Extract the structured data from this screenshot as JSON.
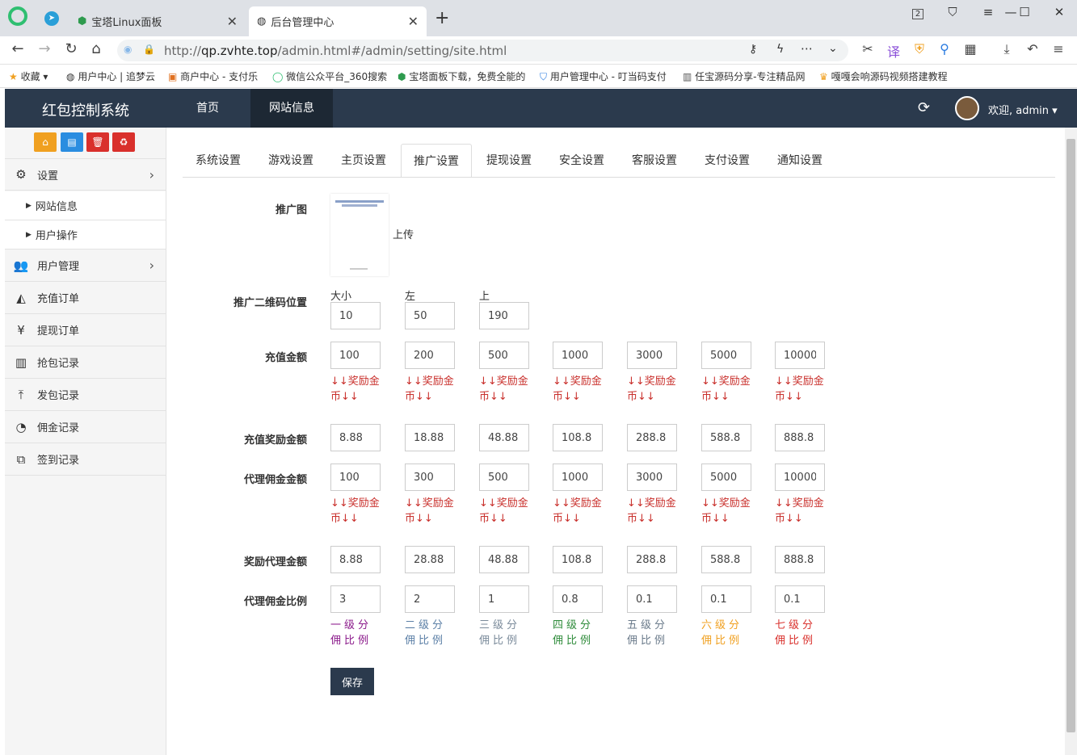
{
  "browser": {
    "tabs": [
      {
        "title": "宝塔Linux面板"
      },
      {
        "title": "后台管理中心"
      }
    ],
    "tab_count_badge": "2",
    "url_prefix": "http://",
    "url_host": "qp.zvhte.top",
    "url_path": "/admin.html#/admin/setting/site.html",
    "bookmarks": [
      "收藏",
      "用户中心 | 追梦云",
      "商户中心 - 支付乐",
      "微信公众平台_360搜索",
      "宝塔面板下载，免费全能的",
      "用户管理中心 - 叮当码支付",
      "任宝源码分享-专注精品网",
      "嘎嘎会响源码视频搭建教程"
    ]
  },
  "header": {
    "brand": "红包控制系统",
    "nav": [
      "首页",
      "网站信息"
    ],
    "welcome": "欢迎, admin"
  },
  "sidebar": {
    "menu": [
      {
        "label": "设置"
      },
      {
        "label": "网站信息"
      },
      {
        "label": "用户操作"
      },
      {
        "label": "用户管理"
      },
      {
        "label": "充值订单"
      },
      {
        "label": "提现订单"
      },
      {
        "label": "抢包记录"
      },
      {
        "label": "发包记录"
      },
      {
        "label": "佣金记录"
      },
      {
        "label": "签到记录"
      }
    ]
  },
  "tabs": [
    "系统设置",
    "游戏设置",
    "主页设置",
    "推广设置",
    "提现设置",
    "安全设置",
    "客服设置",
    "支付设置",
    "通知设置"
  ],
  "form": {
    "promo_image_label": "推广图",
    "upload_label": "上传",
    "qr_position_label": "推广二维码位置",
    "qr_headers": [
      "大小",
      "左",
      "上"
    ],
    "qr_values": [
      "10",
      "50",
      "190"
    ],
    "recharge_amount_label": "充值金额",
    "recharge_amounts": [
      "100",
      "200",
      "500",
      "1000",
      "3000",
      "5000",
      "10000"
    ],
    "reward_hint": "↓↓奖励金币↓↓",
    "recharge_reward_label": "充值奖励金额",
    "recharge_rewards": [
      "8.88",
      "18.88",
      "48.88",
      "108.8",
      "288.8",
      "588.8",
      "888.8"
    ],
    "agent_amount_label": "代理佣金金额",
    "agent_amounts": [
      "100",
      "300",
      "500",
      "1000",
      "3000",
      "5000",
      "10000"
    ],
    "agent_reward_label": "奖励代理金额",
    "agent_rewards": [
      "8.88",
      "28.88",
      "48.88",
      "108.8",
      "288.8",
      "588.8",
      "888.8"
    ],
    "ratio_label": "代理佣金比例",
    "ratios": [
      "3",
      "2",
      "1",
      "0.8",
      "0.1",
      "0.1",
      "0.1"
    ],
    "levels": [
      {
        "text": "一级分佣比例",
        "color": "#8b1a8b"
      },
      {
        "text": "二级分佣比例",
        "color": "#5b7fa6"
      },
      {
        "text": "三级分佣比例",
        "color": "#7a8a9a"
      },
      {
        "text": "四级分佣比例",
        "color": "#2e8b3a"
      },
      {
        "text": "五级分佣比例",
        "color": "#6a7a8a"
      },
      {
        "text": "六级分佣比例",
        "color": "#f0a020"
      },
      {
        "text": "七级分佣比例",
        "color": "#d9302c"
      }
    ],
    "save_label": "保存"
  },
  "colors": {
    "header_bg": "#2b3a4d",
    "hint_red": "#c9302c"
  }
}
